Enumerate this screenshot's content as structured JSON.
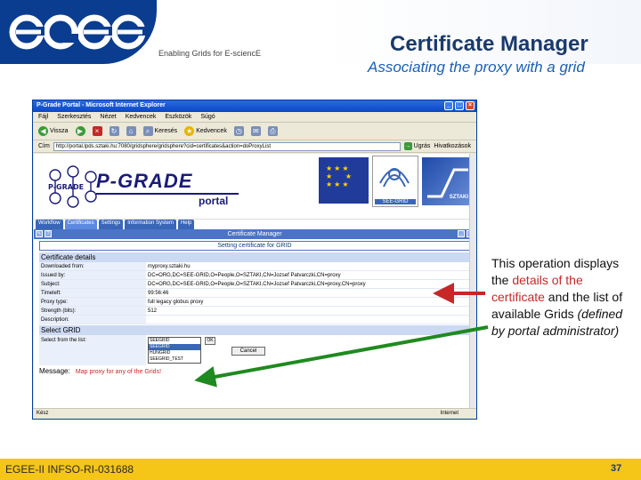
{
  "slide": {
    "logo_text": "egee",
    "tagline": "Enabling Grids for E-sciencE",
    "title": "Certificate Manager",
    "subtitle": "Associating the proxy with a grid",
    "footer_id": "EGEE-II INFSO-RI-031688",
    "page_number": "37",
    "colors": {
      "brand_blue": "#0a3d8f",
      "footer_yellow": "#f5c518",
      "highlight_red": "#c62828",
      "arrow_green": "#1f8a1f"
    }
  },
  "annotation": {
    "part1": "This operation displays the ",
    "highlight1": "details of the certificate",
    "part2": " and the list of  available Grids ",
    "italic": "(defined by portal administrator)"
  },
  "browser": {
    "window_title": "P-Grade Portal - Microsoft Internet Explorer",
    "menu": [
      "Fájl",
      "Szerkesztés",
      "Nézet",
      "Kedvencek",
      "Eszközök",
      "Súgó"
    ],
    "toolbar": {
      "back": "Vissza",
      "search": "Keresés",
      "favorites": "Kedvencek"
    },
    "address_label": "Cím",
    "address_value": "http://portal.lpds.sztaki.hu:7080/gridsphere/gridsphere?cid=certificates&action=doProxyList",
    "go_label": "Ugrás",
    "links_label": "Hivatkozások",
    "status_left": "Kész",
    "status_zone": "Internet"
  },
  "portal": {
    "brand": "P-GRADE",
    "brand_sub": "portal",
    "logo_caption": "P-GRADE",
    "see_grid_label": "SEE-GRID",
    "sztaki_label": "SZTAKI",
    "tabs": [
      "Workflow",
      "Certificates",
      "Settings",
      "Information System",
      "Help"
    ],
    "cm_title": "Certificate Manager",
    "setting_head": "Setting certificate for GRID",
    "cert_section": "Certificate details",
    "details": [
      {
        "label": "Downloaded from:",
        "value": "myproxy.sztaki.hu"
      },
      {
        "label": "Issued by:",
        "value": "DC=ORG,DC=SEE-GRID,O=People,O=SZTAKI,CN=Jozsef Patvarczki,CN=proxy"
      },
      {
        "label": "Subject:",
        "value": "DC=ORG,DC=SEE-GRID,O=People,O=SZTAKI,CN=Jozsef Patvarczki,CN=proxy,CN=proxy"
      },
      {
        "label": "Timeleft:",
        "value": "99:56:46"
      },
      {
        "label": "Proxy type:",
        "value": "full legacy globus proxy"
      },
      {
        "label": "Strength (bits):",
        "value": "512"
      },
      {
        "label": "Description:",
        "value": ""
      }
    ],
    "grid_section": "Select GRID",
    "select_label": "Select from the list:",
    "grid_options": [
      "SEEGRID",
      "SEEGRID",
      "HUNGRID",
      "SEEGRID_TEST"
    ],
    "ok_label": "OK",
    "cancel_label": "Cancel",
    "message_label": "Message:",
    "message_text": "Map proxy for any of the Grids!"
  }
}
